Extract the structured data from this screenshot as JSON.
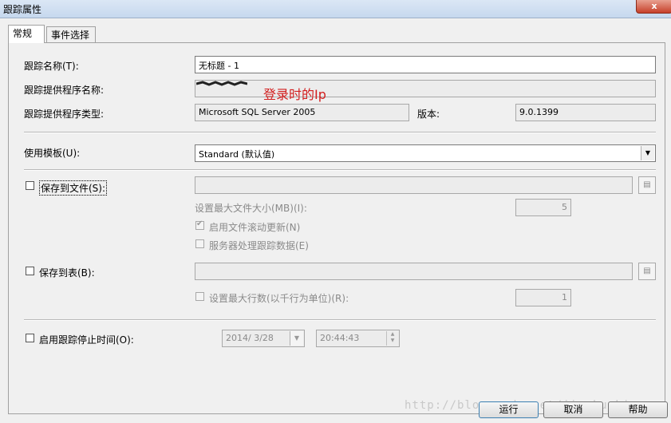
{
  "window": {
    "title": "跟踪属性",
    "close_label": "x"
  },
  "tabs": [
    {
      "label": "常规",
      "active": true
    },
    {
      "label": "事件选择",
      "active": false
    }
  ],
  "general": {
    "trace_name_label": "跟踪名称(T):",
    "trace_name_value": "无标题 - 1",
    "provider_name_label": "跟踪提供程序名称:",
    "provider_name_annotation": "登录时的Ip",
    "provider_type_label": "跟踪提供程序类型:",
    "provider_type_value": "Microsoft SQL Server 2005",
    "version_label": "版本:",
    "version_value": "9.0.1399",
    "template_label": "使用模板(U):",
    "template_value": "Standard (默认值)",
    "save_to_file_label": "保存到文件(S):",
    "max_file_size_label": "设置最大文件大小(MB)(I):",
    "max_file_size_value": "5",
    "enable_rollover_label": "启用文件滚动更新(N)",
    "server_processes_label": "服务器处理跟踪数据(E)",
    "save_to_table_label": "保存到表(B):",
    "max_rows_label": "设置最大行数(以千行为单位)(R):",
    "max_rows_value": "1",
    "stop_time_label": "启用跟踪停止时间(O):",
    "stop_date_value": "2014/ 3/28",
    "stop_time_value": "20:44:43",
    "save_to_file_checked": false,
    "enable_rollover_checked": true,
    "server_processes_checked": false,
    "save_to_table_checked": false,
    "max_rows_checked": false,
    "stop_time_checked": false
  },
  "buttons": {
    "run": "运行",
    "cancel": "取消",
    "help": "帮助"
  },
  "watermark": "http://blog.csdn.net/jiankunking",
  "colors": {
    "annotation": "#d21e1e",
    "title_bar": "#c6d8ee"
  }
}
